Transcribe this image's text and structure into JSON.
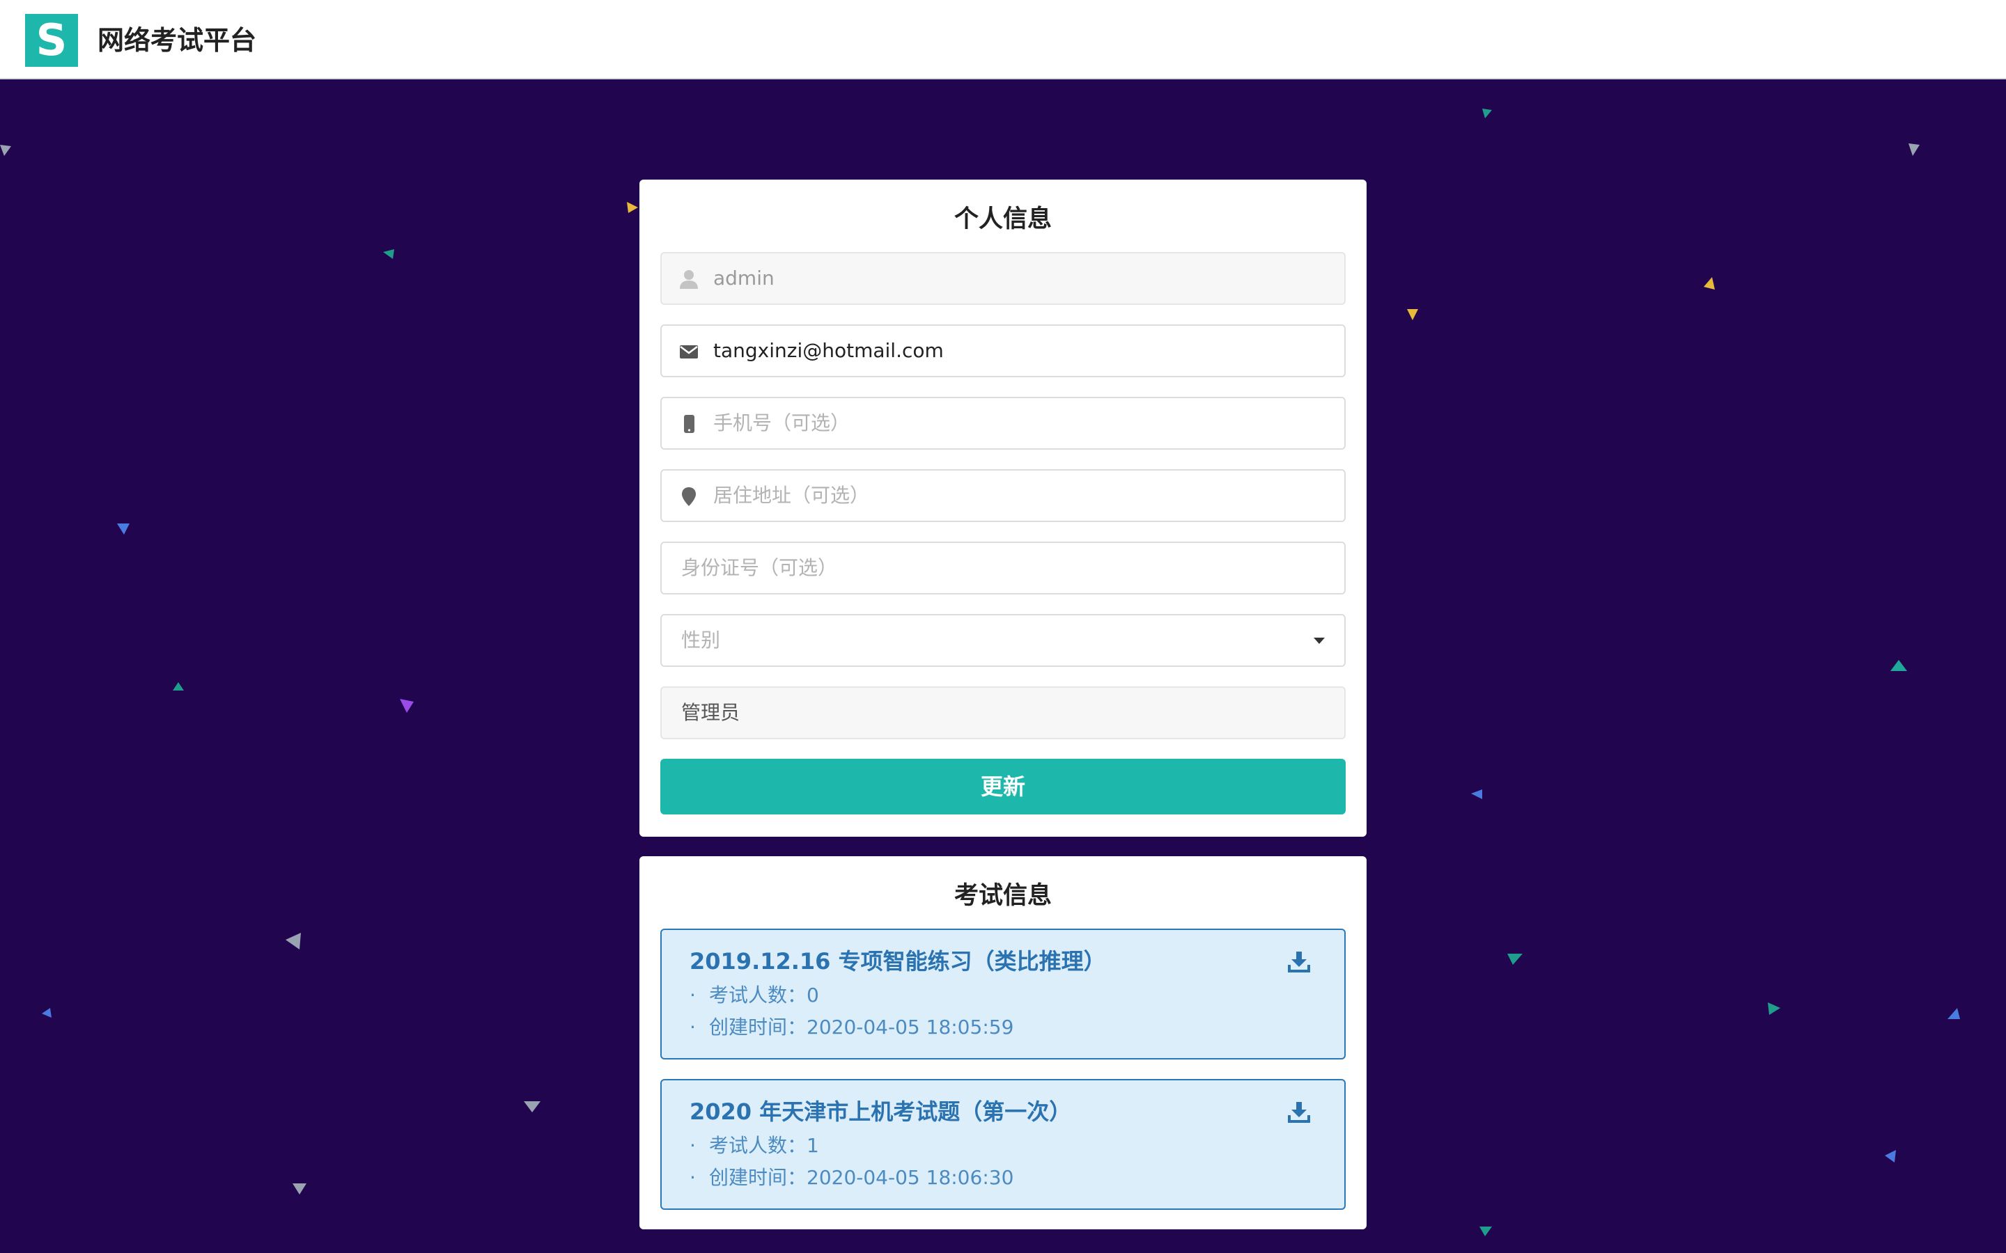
{
  "app": {
    "logo_letter": "S",
    "title": "网络考试平台"
  },
  "profile": {
    "title": "个人信息",
    "username": {
      "icon": "user-icon",
      "value": "admin"
    },
    "email": {
      "icon": "envelope-icon",
      "value": "tangxinzi@hotmail.com"
    },
    "phone": {
      "icon": "mobile-phone-icon",
      "placeholder": "手机号（可选）"
    },
    "address": {
      "icon": "map-pin-icon",
      "placeholder": "居住地址（可选）"
    },
    "id_number": {
      "placeholder": "身份证号（可选）"
    },
    "gender": {
      "placeholder": "性别"
    },
    "role": {
      "value": "管理员"
    },
    "update_label": "更新"
  },
  "exams": {
    "title": "考试信息",
    "items": [
      {
        "title": "2019.12.16 专项智能练习（类比推理）",
        "count_line": "考试人数：0",
        "created_line": "创建时间：2020-04-05 18:05:59",
        "icon": "download-icon"
      },
      {
        "title": "2020 年天津市上机考试题（第一次）",
        "count_line": "考试人数：1",
        "created_line": "创建时间：2020-04-05 18:06:30",
        "icon": "download-icon"
      }
    ]
  },
  "colors": {
    "background": "#22054f",
    "accent": "#1eb7ac",
    "exam_border": "#2a78b8",
    "exam_bg": "#ddeefb",
    "exam_text": "#2b73b0"
  },
  "bullet": "·"
}
